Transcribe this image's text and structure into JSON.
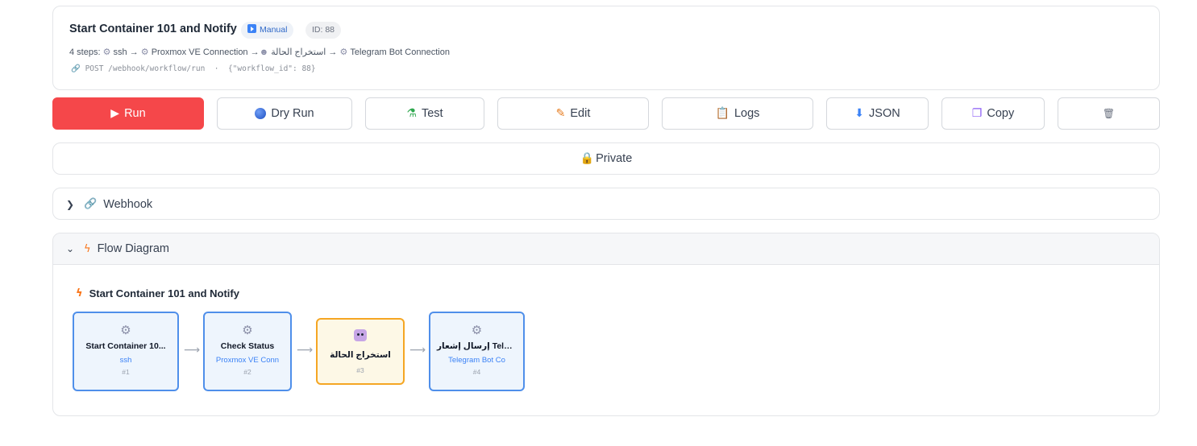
{
  "workflow": {
    "title": "Start Container 101 and Notify",
    "badge_manual": "Manual",
    "badge_id": "ID: 88",
    "steps_prefix": "4 steps:",
    "steps": [
      "ssh",
      "Proxmox VE Connection",
      "استخراج الحالة",
      "Telegram Bot Connection"
    ],
    "arrow": "→",
    "endpoint_method": "POST /webhook/workflow/run",
    "endpoint_sep": "·",
    "endpoint_body": "{\"workflow_id\": 88}"
  },
  "actions": {
    "run": "Run",
    "dry_run": "Dry Run",
    "test": "Test",
    "edit": "Edit",
    "logs": "Logs",
    "json": "JSON",
    "copy": "Copy"
  },
  "visibility": {
    "label": "Private"
  },
  "webhook": {
    "label": "Webhook"
  },
  "flow": {
    "label": "Flow Diagram",
    "title": "Start Container 101 and Notify",
    "nodes": [
      {
        "name": "Start Container 10...",
        "sub": "ssh",
        "num": "#1"
      },
      {
        "name": "Check Status",
        "sub": "Proxmox VE Conn",
        "num": "#2"
      },
      {
        "name": "استخراج الحالة",
        "num": "#3"
      },
      {
        "name": "إرسال إشعار Telegr...",
        "sub": "Telegram Bot Co",
        "num": "#4"
      }
    ]
  },
  "colors": {
    "run": "#f5474a",
    "node_border": "#4f8fea",
    "node_ai_border": "#f5a623",
    "accent": "#3b82f6"
  },
  "icons": [
    "play-icon",
    "gear-icon",
    "link-icon",
    "globe-icon",
    "test-tube-icon",
    "pencil-icon",
    "clipboard-icon",
    "download-icon",
    "copy-icon",
    "trash-icon",
    "lock-icon",
    "chevron-right-icon",
    "chevron-down-icon",
    "lightning-icon",
    "robot-icon",
    "arrow-right-icon"
  ]
}
